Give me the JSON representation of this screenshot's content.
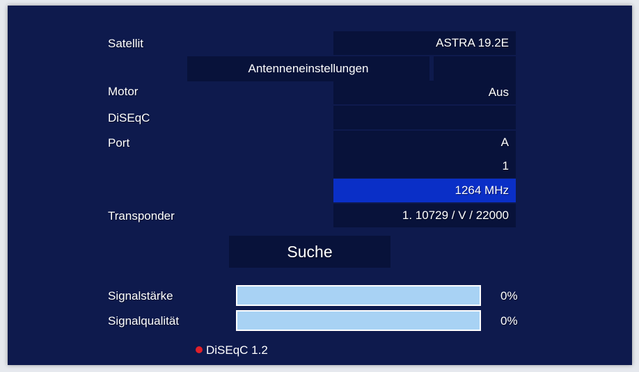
{
  "menu": {
    "satellite": {
      "label": "Satellit",
      "value": "ASTRA 19.2E"
    },
    "antenna_settings_label": "Antenneneinstellungen",
    "motor": {
      "label": "Motor",
      "value": "Aus"
    },
    "diseqc": {
      "label": "DiSEqC",
      "value": ""
    },
    "port": {
      "label": "Port",
      "value": "A"
    },
    "port_number": {
      "value": "1"
    },
    "frequency": {
      "value": "1264 MHz"
    },
    "transponder": {
      "label": "Transponder",
      "value": "1.  10729 / V / 22000"
    },
    "search_label": "Suche"
  },
  "signal": {
    "strength": {
      "label": "Signalstärke",
      "value": "0%",
      "fraction": 0
    },
    "quality": {
      "label": "Signalqualität",
      "value": "0%",
      "fraction": 0
    }
  },
  "footer": {
    "hint_label": "DiSEqC 1.2",
    "hint_color": "#e0202a"
  },
  "colors": {
    "background": "#0e1a4d",
    "highlight": "#0a2fc7",
    "bar_empty": "#a8d2f4"
  }
}
